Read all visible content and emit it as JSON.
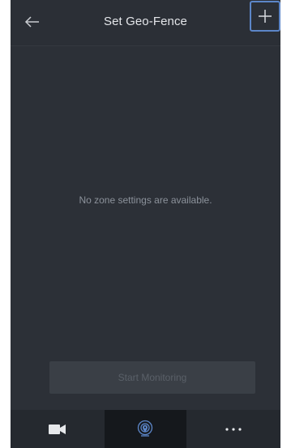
{
  "header": {
    "back_icon": "arrow-left-icon",
    "title": "Set Geo-Fence",
    "add_icon": "plus-icon",
    "add_highlight_color": "#5c86c8"
  },
  "main": {
    "empty_message": "No zone settings are available.",
    "start_button_label": "Start Monitoring"
  },
  "bottom_nav": {
    "items": [
      {
        "icon": "video-camera-icon",
        "active": false
      },
      {
        "icon": "geofence-location-icon",
        "active": true
      },
      {
        "icon": "more-dots-icon",
        "active": false
      }
    ]
  }
}
